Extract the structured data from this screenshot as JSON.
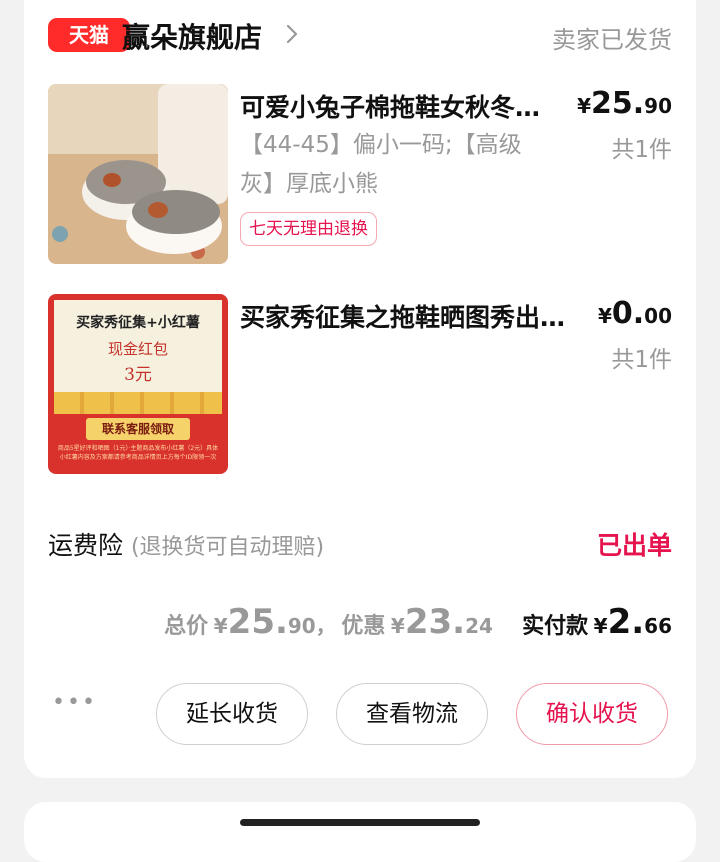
{
  "header": {
    "platform_badge": "天猫",
    "shop_name": "赢朵旗舰店",
    "order_status": "卖家已发货"
  },
  "items": [
    {
      "title": "可爱小兔子棉拖鞋女秋冬…",
      "price_currency": "¥",
      "price_int": "25.",
      "price_dec": "90",
      "quantity": "共1件",
      "spec_line1": "【44-45】偏小一码;【高级",
      "spec_line2": "灰】厚底小熊",
      "tag": "七天无理由退换"
    },
    {
      "title": "买家秀征集之拖鞋晒图秀出…",
      "price_currency": "¥",
      "price_int": "0.",
      "price_dec": "00",
      "quantity": "共1件",
      "image_text": {
        "headline": "买家秀征集+小红薯",
        "line1": "现金红包",
        "line2": "3元",
        "button": "联系客服领取",
        "fine_print": "商品5星好评和晒图（1元）·主题商品发布小红薯（2元）具体小红薯内容及方案都请参考商品详情页上方每个ID限领一次"
      }
    }
  ],
  "insurance": {
    "label": "运费险",
    "sub": "(退换货可自动理赔)",
    "status": "已出单"
  },
  "totals": {
    "total_label": "总价",
    "total_currency": "¥",
    "total_int": "25.",
    "total_dec": "90，",
    "discount_label": "优惠",
    "discount_currency": "¥",
    "discount_int": "23.",
    "discount_dec": "24",
    "paid_label": "实付款",
    "paid_currency": "¥",
    "paid_int": "2.",
    "paid_dec": "66"
  },
  "actions": {
    "more": "•••",
    "extend": "延长收货",
    "logistics": "查看物流",
    "confirm": "确认收货"
  },
  "colors": {
    "brand_red": "#ff2a2a",
    "accent": "#e5134e",
    "muted": "#999999"
  }
}
